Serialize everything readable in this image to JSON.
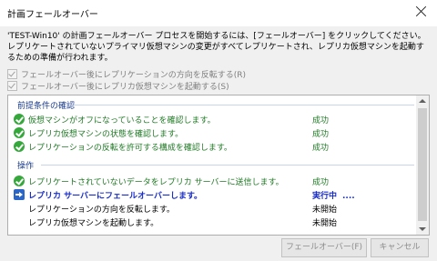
{
  "window": {
    "title": "計画フェールオーバー"
  },
  "description": "'TEST-Win10' の計画フェールオーバー プロセスを開始するには、[フェールオーバー] をクリックしてください。レプリケートされていないプライマリ仮想マシンの変更がすべてレプリケートされ、レプリカ仮想マシンを起動するための準備が行われます。",
  "options": [
    {
      "label": "フェールオーバー後にレプリケーションの方向を反転する(R)",
      "checked": true,
      "enabled": false
    },
    {
      "label": "フェールオーバー後にレプリカ仮想マシンを起動する(S)",
      "checked": true,
      "enabled": false
    }
  ],
  "sections": {
    "prereq": "前提条件の確認",
    "ops": "操作"
  },
  "prereq_rows": [
    {
      "icon": "check-icon",
      "text": "仮想マシンがオフになっていることを確認します。",
      "status": "成功"
    },
    {
      "icon": "check-icon",
      "text": "レプリカ仮想マシンの状態を確認します。",
      "status": "成功"
    },
    {
      "icon": "check-icon",
      "text": "レプリケーションの反転を許可する構成を確認します。",
      "status": "成功"
    }
  ],
  "op_rows": [
    {
      "icon": "check-icon",
      "text": "レプリケートされていないデータをレプリカ サーバーに送信します。",
      "status": "成功"
    },
    {
      "icon": "arrow-icon",
      "text": "レプリカ サーバーにフェールオーバーします。",
      "status": "実行中",
      "progress": "...."
    },
    {
      "icon": "",
      "text": "レプリケーションの方向を反転します。",
      "status": "未開始"
    },
    {
      "icon": "",
      "text": "レプリカ仮想マシンを起動します。",
      "status": "未開始"
    }
  ],
  "buttons": {
    "failover": "フェールオーバー(F)",
    "cancel": "キャンセル"
  },
  "colors": {
    "success": "#1f7a24",
    "running": "#1a2ec8",
    "section": "#1a3c8c"
  }
}
